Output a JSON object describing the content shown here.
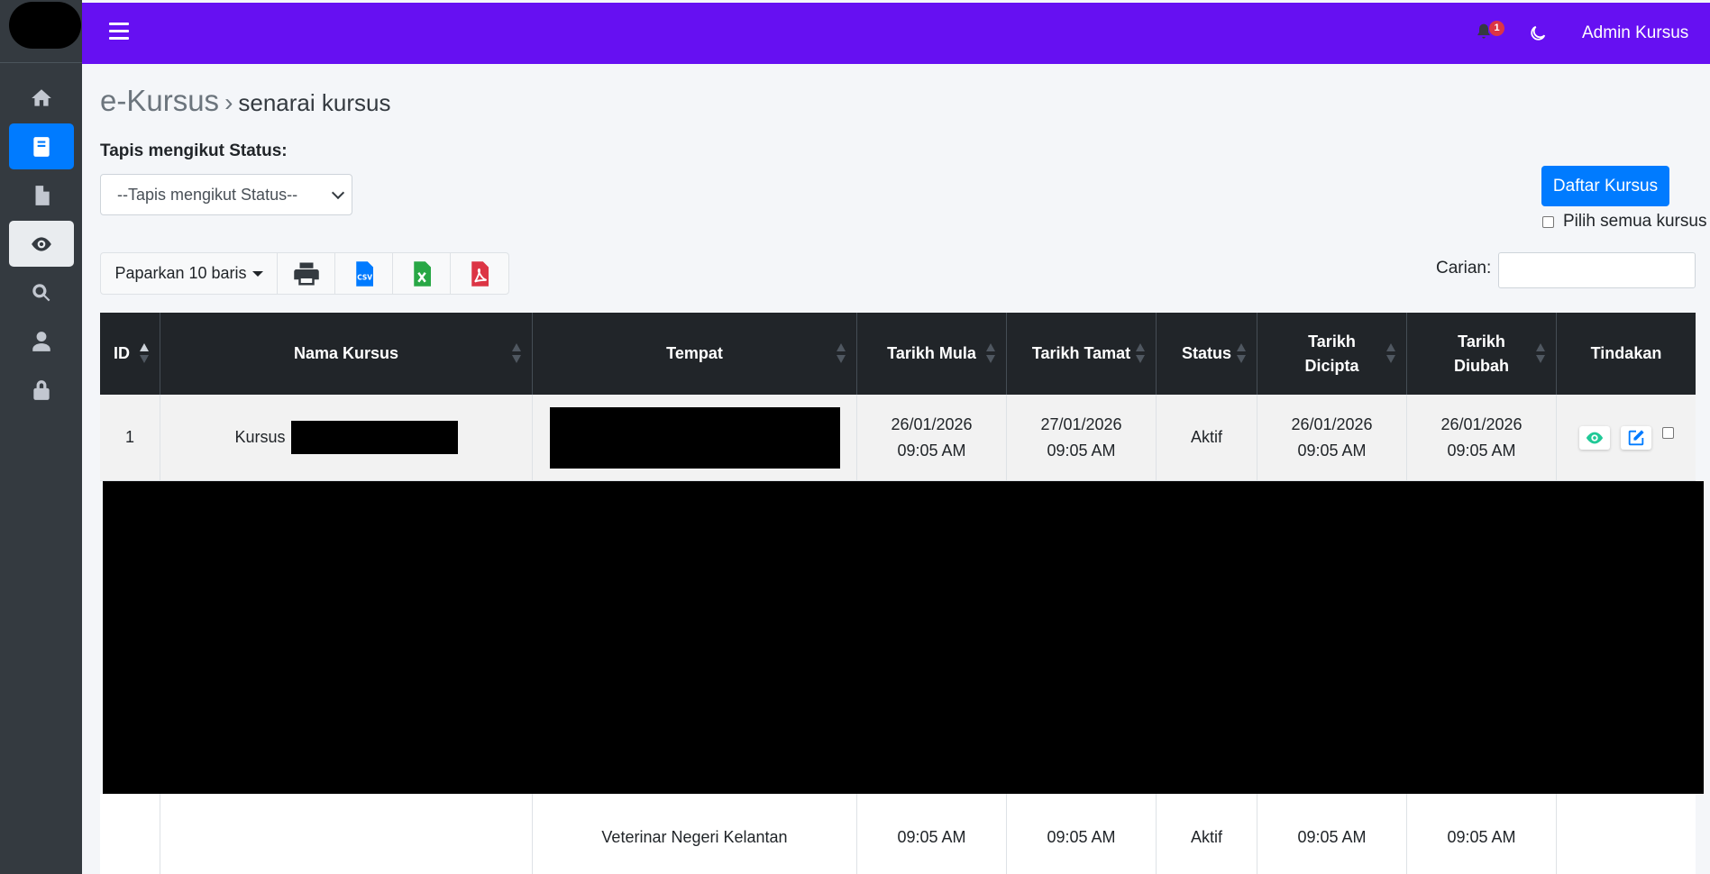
{
  "topbar": {
    "user_name": "Admin Kursus",
    "notification_count": "1"
  },
  "breadcrumb": {
    "root": "e-Kursus",
    "separator": "›",
    "current": "senarai kursus"
  },
  "filter": {
    "label": "Tapis mengikut Status:",
    "selected": "--Tapis mengikut Status--"
  },
  "actions": {
    "register_button": "Daftar Kursus",
    "select_all_label": "Pilih semua kursus"
  },
  "toolbar": {
    "page_length": "Paparkan 10 baris",
    "export_icons": [
      "print-icon",
      "csv-icon",
      "excel-icon",
      "pdf-icon"
    ]
  },
  "search": {
    "label": "Carian:",
    "value": ""
  },
  "table": {
    "headers": [
      "ID",
      "Nama Kursus",
      "Tempat",
      "Tarikh Mula",
      "Tarikh Tamat",
      "Status",
      "Tarikh\nDicipta",
      "Tarikh\nDiubah",
      "Tindakan"
    ],
    "rows": [
      {
        "id": "1",
        "name_prefix": "Kursus",
        "start_date": "26/01/2026",
        "start_time": "09:05 AM",
        "end_date": "27/01/2026",
        "end_time": "09:05 AM",
        "status": "Aktif",
        "created_date": "26/01/2026",
        "created_time": "09:05 AM",
        "updated_date": "26/01/2026",
        "updated_time": "09:05 AM"
      }
    ],
    "partial_row": {
      "place": "Veterinar Negeri Kelantan",
      "start_time": "09:05 AM",
      "end_time": "09:05 AM",
      "status": "Aktif",
      "created_time": "09:05 AM",
      "updated_time": "09:05 AM"
    }
  },
  "colors": {
    "navbar": "#6610f2",
    "sidebar": "#343a40",
    "primary": "#007bff",
    "table_header": "#212529"
  },
  "sidebar_icons": [
    "home-icon",
    "book-icon",
    "file-icon",
    "eye-icon",
    "search-icon",
    "user-icon",
    "lock-icon"
  ]
}
